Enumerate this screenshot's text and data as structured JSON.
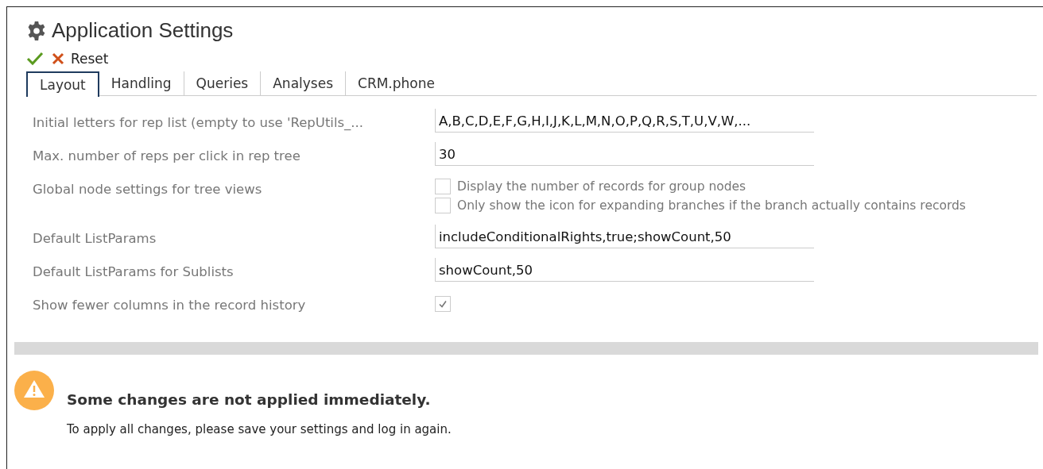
{
  "window": {
    "title": "Application Settings"
  },
  "toolbar": {
    "reset_label": "Reset"
  },
  "tabs": [
    {
      "label": "Layout",
      "selected": true
    },
    {
      "label": "Handling",
      "selected": false
    },
    {
      "label": "Queries",
      "selected": false
    },
    {
      "label": "Analyses",
      "selected": false
    },
    {
      "label": "CRM.phone",
      "selected": false
    }
  ],
  "settings": [
    {
      "kind": "text",
      "label": "Initial letters for rep list (empty to use 'RepUtils_...",
      "value": "A,B,C,D,E,F,G,H,I,J,K,L,M,N,O,P,Q,R,S,T,U,V,W,..."
    },
    {
      "kind": "text",
      "label": "Max. number of reps per click in rep tree",
      "value": "30"
    },
    {
      "kind": "checkboxes",
      "label": "Global node settings for tree views",
      "options": [
        {
          "label": "Display the number of records for group nodes",
          "checked": false
        },
        {
          "label": "Only show the icon for expanding branches if the branch actually contains records",
          "checked": false
        }
      ]
    },
    {
      "kind": "text",
      "label": "Default ListParams",
      "value": "includeConditionalRights,true;showCount,50"
    },
    {
      "kind": "text",
      "label": "Default ListParams for Sublists",
      "value": "showCount,50"
    },
    {
      "kind": "checkbox",
      "label": "Show fewer columns in the record history",
      "checked": true
    }
  ],
  "notice": {
    "heading": "Some changes are not applied immediately.",
    "text": "To apply all changes, please save your settings and log in again."
  }
}
